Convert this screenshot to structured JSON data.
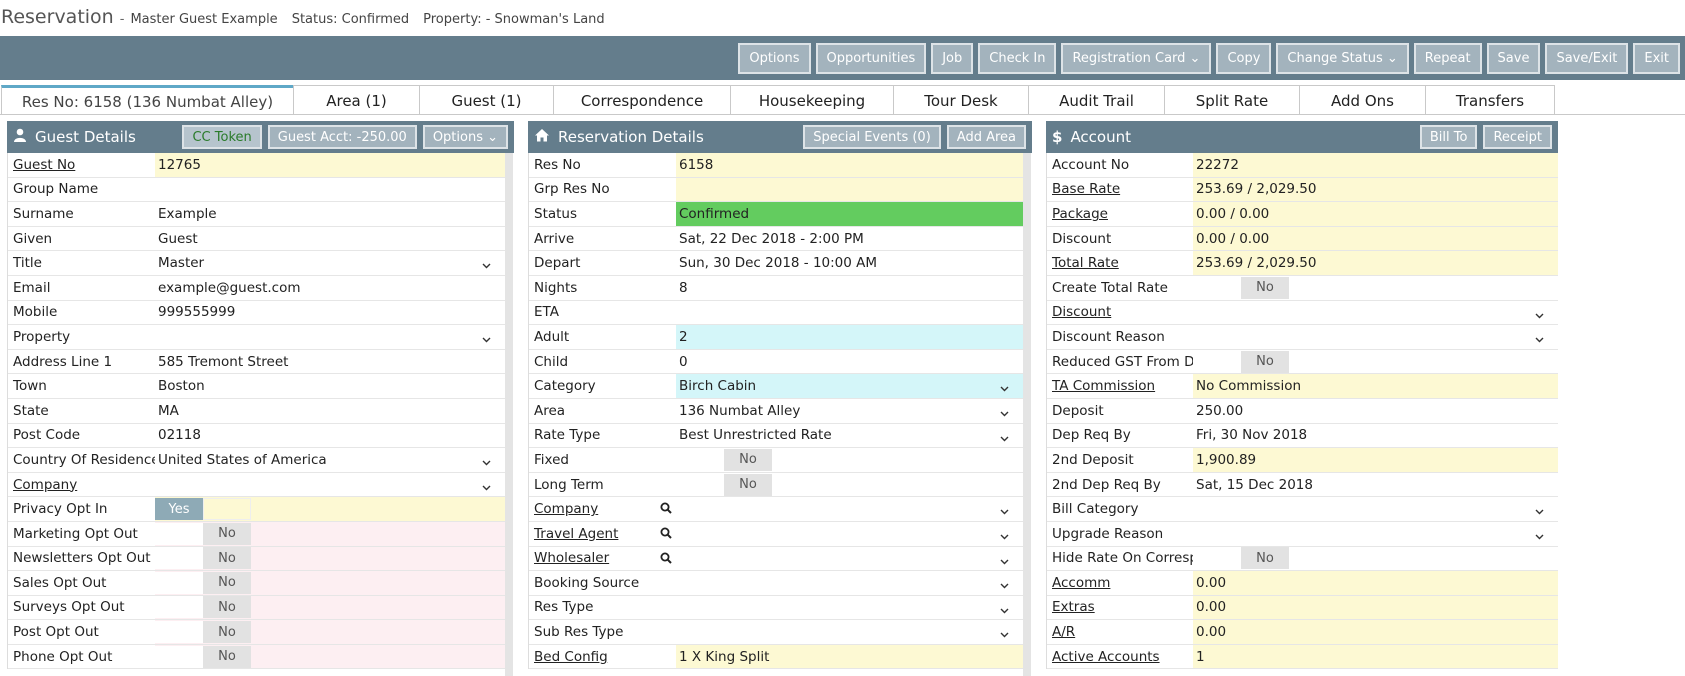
{
  "header": {
    "app": "Reservation",
    "dash": "-",
    "guest": "Master Guest Example",
    "status": "Status: Confirmed",
    "property": "Property: - Snowman's Land"
  },
  "toolbar": [
    "Options",
    "Opportunities",
    "Job",
    "Check In",
    "Registration Card ⌄",
    "Copy",
    "Change Status ⌄",
    "Repeat",
    "Save",
    "Save/Exit",
    "Exit"
  ],
  "tabs": [
    "Res No: 6158 (136 Numbat Alley)",
    "Area (1)",
    "Guest (1)",
    "Correspondence",
    "Housekeeping",
    "Tour Desk",
    "Audit Trail",
    "Split Rate",
    "Add Ons",
    "Transfers"
  ],
  "guest_panel": {
    "title": "Guest Details",
    "buttons": [
      "CC Token",
      "Guest Acct: -250.00",
      "Options ⌄"
    ],
    "rows": [
      {
        "label": "Guest No",
        "value": "12765",
        "link": true,
        "bg": "yellow"
      },
      {
        "label": "Group Name",
        "value": ""
      },
      {
        "label": "Surname",
        "value": "Example"
      },
      {
        "label": "Given",
        "value": "Guest"
      },
      {
        "label": "Title",
        "value": "Master",
        "dropdown": true
      },
      {
        "label": "Email",
        "value": "example@guest.com"
      },
      {
        "label": "Mobile",
        "value": "999555999"
      },
      {
        "label": "Property",
        "value": "",
        "dropdown": true
      },
      {
        "label": "Address Line 1",
        "value": "585 Tremont Street"
      },
      {
        "label": "Town",
        "value": "Boston"
      },
      {
        "label": "State",
        "value": "MA"
      },
      {
        "label": "Post Code",
        "value": "02118"
      },
      {
        "label": "Country Of Residence",
        "value": "United States of America",
        "dropdown": true
      },
      {
        "label": "Company",
        "value": "",
        "link": true,
        "dropdown": true
      },
      {
        "label": "Privacy Opt In",
        "toggle": "Yes",
        "bg": "yellow"
      },
      {
        "label": "Marketing Opt Out",
        "toggle": "No",
        "bg": "pink"
      },
      {
        "label": "Newsletters Opt Out",
        "toggle": "No",
        "bg": "pink"
      },
      {
        "label": "Sales Opt Out",
        "toggle": "No",
        "bg": "pink"
      },
      {
        "label": "Surveys Opt Out",
        "toggle": "No",
        "bg": "pink"
      },
      {
        "label": "Post Opt Out",
        "toggle": "No",
        "bg": "pink"
      },
      {
        "label": "Phone Opt Out",
        "toggle": "No",
        "bg": "pink"
      }
    ]
  },
  "res_panel": {
    "title": "Reservation Details",
    "buttons": [
      "Special Events (0)",
      "Add Area"
    ],
    "rows": [
      {
        "label": "Res No",
        "value": "6158",
        "bg": "yellow"
      },
      {
        "label": "Grp Res No",
        "value": "",
        "bg": "yellow"
      },
      {
        "label": "Status",
        "value": "Confirmed",
        "bg": "green"
      },
      {
        "label": "Arrive",
        "value": "Sat, 22 Dec 2018 - 2:00 PM"
      },
      {
        "label": "Depart",
        "value": "Sun, 30 Dec 2018 - 10:00 AM"
      },
      {
        "label": "Nights",
        "value": "8"
      },
      {
        "label": "ETA",
        "value": ""
      },
      {
        "label": "Adult",
        "value": "2",
        "bg": "cyan"
      },
      {
        "label": "Child",
        "value": "0"
      },
      {
        "label": "Category",
        "value": "Birch Cabin",
        "bg": "cyan",
        "dropdown": true
      },
      {
        "label": "Area",
        "value": "136 Numbat Alley",
        "dropdown": true
      },
      {
        "label": "Rate Type",
        "value": "Best Unrestricted Rate",
        "dropdown": true
      },
      {
        "label": "Fixed",
        "toggle": "No"
      },
      {
        "label": "Long Term",
        "toggle": "No"
      },
      {
        "label": "Company",
        "value": "",
        "link": true,
        "search": true,
        "dropdown": true
      },
      {
        "label": "Travel Agent",
        "value": "",
        "link": true,
        "search": true,
        "dropdown": true
      },
      {
        "label": "Wholesaler",
        "value": "",
        "link": true,
        "search": true,
        "dropdown": true
      },
      {
        "label": "Booking Source",
        "value": "",
        "dropdown": true
      },
      {
        "label": "Res Type",
        "value": "",
        "dropdown": true
      },
      {
        "label": "Sub Res Type",
        "value": "",
        "dropdown": true
      },
      {
        "label": "Bed Config",
        "value": "1 X King Split",
        "link": true,
        "bg": "yellow"
      }
    ]
  },
  "acct_panel": {
    "title": "Account",
    "buttons": [
      "Bill To",
      "Receipt"
    ],
    "rows": [
      {
        "label": "Account No",
        "value": "22272",
        "bg": "yellow"
      },
      {
        "label": "Base Rate",
        "value": "253.69 / 2,029.50",
        "link": true,
        "bg": "yellow"
      },
      {
        "label": "Package",
        "value": "0.00 / 0.00",
        "link": true,
        "bg": "yellow"
      },
      {
        "label": "Discount",
        "value": "0.00 / 0.00",
        "bg": "yellow"
      },
      {
        "label": "Total Rate",
        "value": "253.69 / 2,029.50",
        "link": true,
        "bg": "yellow"
      },
      {
        "label": "Create Total Rate",
        "toggle": "No"
      },
      {
        "label": "Discount",
        "value": "",
        "link": true,
        "dropdown": true
      },
      {
        "label": "Discount Reason",
        "value": "",
        "dropdown": true
      },
      {
        "label": "Reduced GST From D...",
        "toggle": "No"
      },
      {
        "label": "TA Commission",
        "value": "No Commission",
        "link": true,
        "bg": "yellow"
      },
      {
        "label": "Deposit",
        "value": "250.00"
      },
      {
        "label": "Dep Req By",
        "value": "Fri, 30 Nov 2018"
      },
      {
        "label": "2nd Deposit",
        "value": "1,900.89",
        "bg": "yellow"
      },
      {
        "label": "2nd Dep Req By",
        "value": "Sat, 15 Dec 2018"
      },
      {
        "label": "Bill Category",
        "value": "",
        "dropdown": true
      },
      {
        "label": "Upgrade Reason",
        "value": "",
        "dropdown": true
      },
      {
        "label": "Hide Rate On Corresp...",
        "toggle": "No"
      },
      {
        "label": "Accomm",
        "value": "0.00",
        "link": true,
        "bg": "yellow"
      },
      {
        "label": "Extras",
        "value": "0.00",
        "link": true,
        "bg": "yellow"
      },
      {
        "label": "A/R",
        "value": "0.00",
        "link": true,
        "bg": "yellow"
      },
      {
        "label": "Active Accounts",
        "value": "1",
        "link": true,
        "bg": "yellow"
      }
    ]
  }
}
